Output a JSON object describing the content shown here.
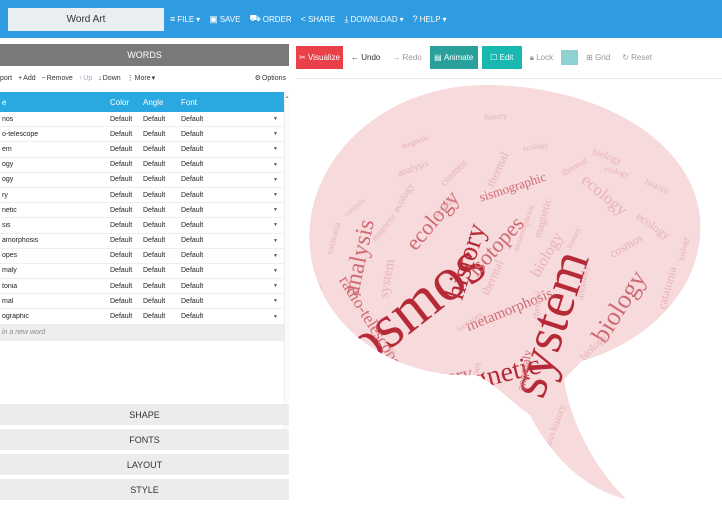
{
  "app_title": "Word Art",
  "menu": [
    {
      "icon": "≡",
      "label": "FILE",
      "caret": "▾"
    },
    {
      "icon": "▣",
      "label": "SAVE",
      "caret": ""
    },
    {
      "icon": "⛟",
      "label": "ORDER",
      "caret": ""
    },
    {
      "icon": "<",
      "label": "SHARE",
      "caret": ""
    },
    {
      "icon": "⤓",
      "label": "DOWNLOAD",
      "caret": "▾"
    },
    {
      "icon": "?",
      "label": "HELP",
      "caret": "▾"
    }
  ],
  "words_panel": {
    "header": "WORDS",
    "toolbar": {
      "import": "port",
      "add": "Add",
      "remove": "Remove",
      "up": "Up",
      "down": "Down",
      "more": "More",
      "options": "Options"
    },
    "columns": {
      "word": "e",
      "color": "Color",
      "angle": "Angle",
      "font": "Font"
    },
    "rows": [
      {
        "word": "nos",
        "color": "Default",
        "angle": "Default",
        "font": "Default"
      },
      {
        "word": "o-telescope",
        "color": "Default",
        "angle": "Default",
        "font": "Default"
      },
      {
        "word": "em",
        "color": "Default",
        "angle": "Default",
        "font": "Default"
      },
      {
        "word": "ogy",
        "color": "Default",
        "angle": "Default",
        "font": "Default"
      },
      {
        "word": "ogy",
        "color": "Default",
        "angle": "Default",
        "font": "Default"
      },
      {
        "word": "ry",
        "color": "Default",
        "angle": "Default",
        "font": "Default"
      },
      {
        "word": "netic",
        "color": "Default",
        "angle": "Default",
        "font": "Default"
      },
      {
        "word": "sis",
        "color": "Default",
        "angle": "Default",
        "font": "Default"
      },
      {
        "word": "amorphosis",
        "color": "Default",
        "angle": "Default",
        "font": "Default"
      },
      {
        "word": "opes",
        "color": "Default",
        "angle": "Default",
        "font": "Default"
      },
      {
        "word": "maly",
        "color": "Default",
        "angle": "Default",
        "font": "Default"
      },
      {
        "word": "tonia",
        "color": "Default",
        "angle": "Default",
        "font": "Default"
      },
      {
        "word": "mal",
        "color": "Default",
        "angle": "Default",
        "font": "Default"
      },
      {
        "word": "ographic",
        "color": "Default",
        "angle": "Default",
        "font": "Default"
      }
    ],
    "new_word_placeholder": "in a new word"
  },
  "sections": [
    "SHAPE",
    "FONTS",
    "LAYOUT",
    "STYLE"
  ],
  "toolbar_right": {
    "visualize": "Visualize",
    "undo": "Undo",
    "redo": "Redo",
    "animate": "Animate",
    "edit": "Edit",
    "lock": "Lock",
    "grid": "Grid",
    "reset": "Reset"
  },
  "colors": {
    "top_bar": "#2f9be0",
    "table_header": "#2aa8e0",
    "visualize": "#e9404a",
    "animate": "#2aa09d",
    "edit": "#18b8b0",
    "cloud_dark": "#b52a36",
    "cloud_mid": "#d06a72",
    "cloud_light": "#e8b2b6"
  },
  "cloud_words": [
    {
      "t": "cosmos",
      "c": "dark"
    },
    {
      "t": "system",
      "c": "dark"
    },
    {
      "t": "magnetic",
      "c": "dark"
    },
    {
      "t": "history",
      "c": "dark"
    },
    {
      "t": "biology",
      "c": "mid"
    },
    {
      "t": "analysis",
      "c": "mid"
    },
    {
      "t": "ecology",
      "c": "mid"
    },
    {
      "t": "isotopes",
      "c": "mid"
    },
    {
      "t": "radio-telescope",
      "c": "mid"
    },
    {
      "t": "metamorphosis",
      "c": "mid"
    },
    {
      "t": "history",
      "c": "mid"
    },
    {
      "t": "catatonia",
      "c": "mid"
    },
    {
      "t": "sismographic",
      "c": "mid"
    },
    {
      "t": "anomaly",
      "c": "mid"
    },
    {
      "t": "thermal",
      "c": "light"
    },
    {
      "t": "ecology",
      "c": "light"
    },
    {
      "t": "cosmos",
      "c": "light"
    },
    {
      "t": "catatonia",
      "c": "light"
    },
    {
      "t": "biology",
      "c": "light"
    },
    {
      "t": "system",
      "c": "light"
    },
    {
      "t": "cosmos",
      "c": "light"
    },
    {
      "t": "magnetic",
      "c": "light"
    },
    {
      "t": "ecology",
      "c": "light"
    },
    {
      "t": "analysis",
      "c": "light"
    },
    {
      "t": "isotopes",
      "c": "light"
    },
    {
      "t": "thermal",
      "c": "light"
    },
    {
      "t": "cosmos",
      "c": "light"
    },
    {
      "t": "analysis",
      "c": "light"
    },
    {
      "t": "biology",
      "c": "light"
    },
    {
      "t": "history",
      "c": "light"
    },
    {
      "t": "system",
      "c": "light"
    },
    {
      "t": "ecology",
      "c": "light"
    },
    {
      "t": "history",
      "c": "light"
    },
    {
      "t": "metamorphosis",
      "c": "light"
    },
    {
      "t": "thermal",
      "c": "light"
    },
    {
      "t": "anomaly",
      "c": "light"
    },
    {
      "t": "isotopes",
      "c": "light"
    },
    {
      "t": "radio-telescope",
      "c": "light"
    },
    {
      "t": "biology",
      "c": "light"
    },
    {
      "t": "catatonia",
      "c": "light"
    },
    {
      "t": "magnetic",
      "c": "light"
    },
    {
      "t": "system",
      "c": "light"
    },
    {
      "t": "analysis",
      "c": "light"
    },
    {
      "t": "thermal",
      "c": "light"
    },
    {
      "t": "history",
      "c": "light"
    },
    {
      "t": "biology",
      "c": "light"
    },
    {
      "t": "metamorphosis",
      "c": "light"
    },
    {
      "t": "cosmos",
      "c": "light"
    },
    {
      "t": "history",
      "c": "light"
    },
    {
      "t": "ecology",
      "c": "light"
    },
    {
      "t": "magnetic",
      "c": "light"
    },
    {
      "t": "biology",
      "c": "light"
    },
    {
      "t": "history",
      "c": "light"
    },
    {
      "t": "ecology",
      "c": "light"
    },
    {
      "t": "metamorphosis",
      "c": "light"
    },
    {
      "t": "biology",
      "c": "light"
    },
    {
      "t": "history",
      "c": "light"
    }
  ]
}
